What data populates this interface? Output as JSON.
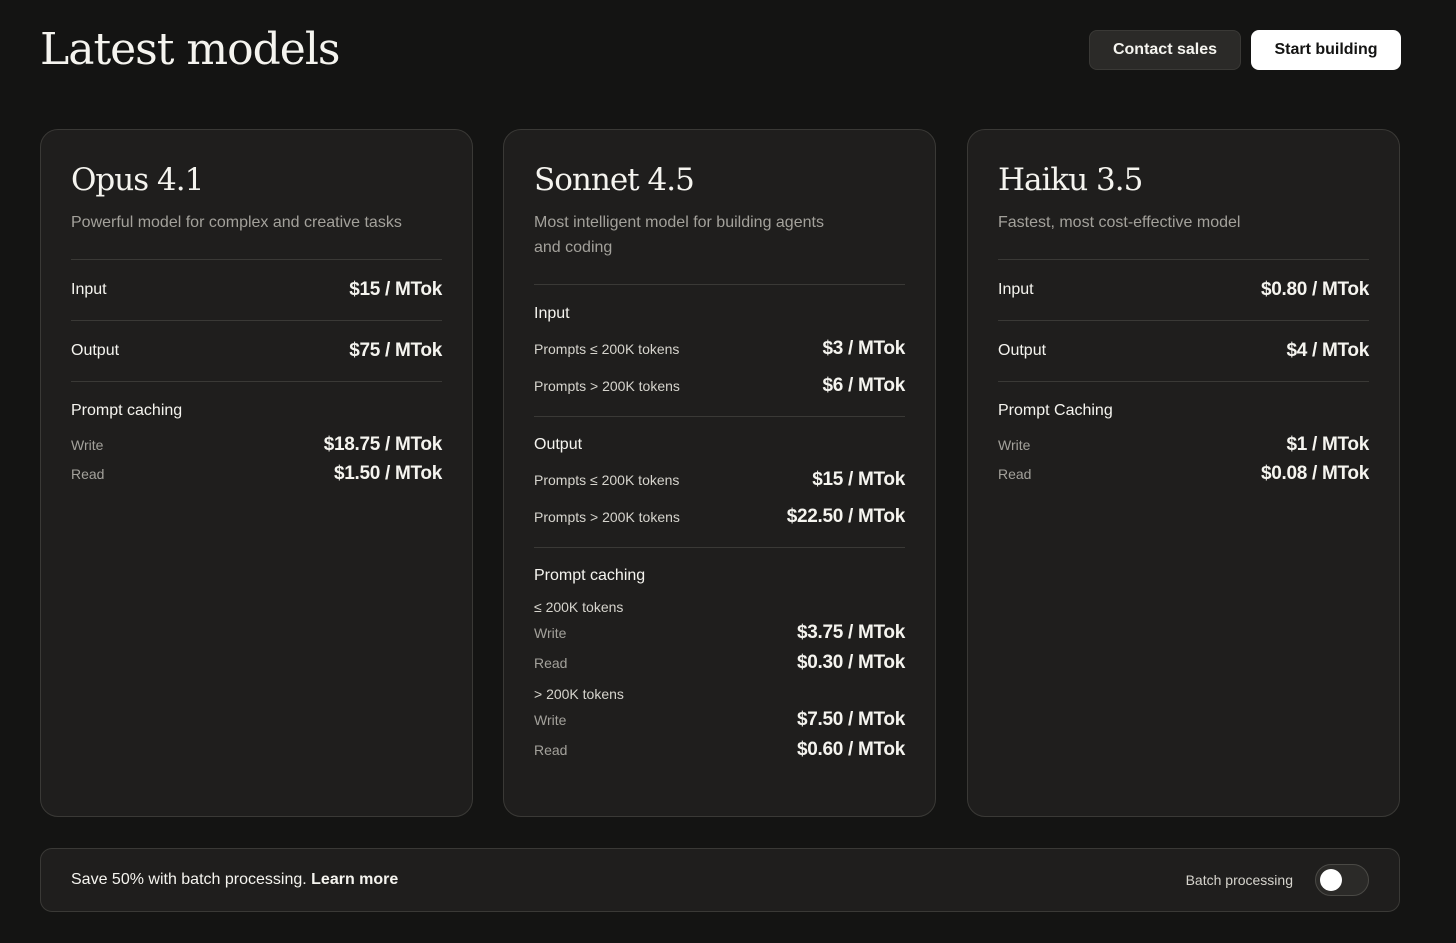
{
  "header": {
    "title": "Latest models",
    "contact_label": "Contact sales",
    "start_label": "Start building"
  },
  "opus": {
    "name": "Opus 4.1",
    "description": "Powerful model for complex and creative tasks",
    "input_label": "Input",
    "input_price": "$15 / MTok",
    "output_label": "Output",
    "output_price": "$75 / MTok",
    "caching_label": "Prompt caching",
    "write_label": "Write",
    "write_price": "$18.75 / MTok",
    "read_label": "Read",
    "read_price": "$1.50 / MTok"
  },
  "sonnet": {
    "name": "Sonnet 4.5",
    "description": "Most intelligent model for building agents and coding",
    "input_label": "Input",
    "input_small_label": "Prompts ≤ 200K tokens",
    "input_small_price": "$3 / MTok",
    "input_large_label": "Prompts > 200K tokens",
    "input_large_price": "$6 / MTok",
    "output_label": "Output",
    "output_small_label": "Prompts ≤ 200K tokens",
    "output_small_price": "$15 / MTok",
    "output_large_label": "Prompts > 200K tokens",
    "output_large_price": "$22.50 / MTok",
    "caching_label": "Prompt caching",
    "tier_small_label": "≤ 200K tokens",
    "tier_small_write_label": "Write",
    "tier_small_write_price": "$3.75 / MTok",
    "tier_small_read_label": "Read",
    "tier_small_read_price": "$0.30 / MTok",
    "tier_large_label": "> 200K tokens",
    "tier_large_write_label": "Write",
    "tier_large_write_price": "$7.50 / MTok",
    "tier_large_read_label": "Read",
    "tier_large_read_price": "$0.60 / MTok"
  },
  "haiku": {
    "name": "Haiku 3.5",
    "description": "Fastest, most cost-effective model",
    "input_label": "Input",
    "input_price": "$0.80 / MTok",
    "output_label": "Output",
    "output_price": "$4 / MTok",
    "caching_label": "Prompt Caching",
    "write_label": "Write",
    "write_price": "$1 / MTok",
    "read_label": "Read",
    "read_price": "$0.08 / MTok"
  },
  "banner": {
    "text": "Save 50% with batch processing.",
    "link": "Learn more",
    "toggle_label": "Batch processing",
    "toggle_on": false
  }
}
